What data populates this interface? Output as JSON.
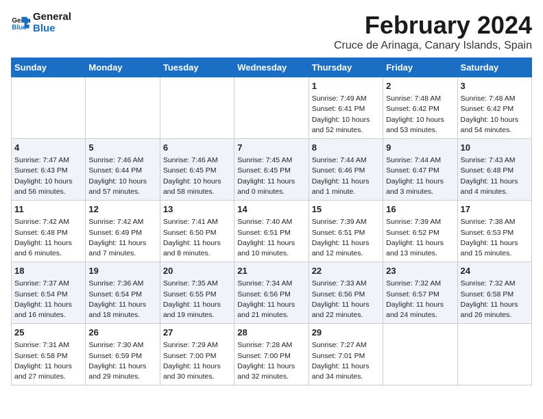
{
  "logo": {
    "text_general": "General",
    "text_blue": "Blue"
  },
  "title": {
    "month": "February 2024",
    "location": "Cruce de Arinaga, Canary Islands, Spain"
  },
  "days_of_week": [
    "Sunday",
    "Monday",
    "Tuesday",
    "Wednesday",
    "Thursday",
    "Friday",
    "Saturday"
  ],
  "weeks": [
    [
      {
        "day": "",
        "info": ""
      },
      {
        "day": "",
        "info": ""
      },
      {
        "day": "",
        "info": ""
      },
      {
        "day": "",
        "info": ""
      },
      {
        "day": "1",
        "info": "Sunrise: 7:49 AM\nSunset: 6:41 PM\nDaylight: 10 hours and 52 minutes."
      },
      {
        "day": "2",
        "info": "Sunrise: 7:48 AM\nSunset: 6:42 PM\nDaylight: 10 hours and 53 minutes."
      },
      {
        "day": "3",
        "info": "Sunrise: 7:48 AM\nSunset: 6:42 PM\nDaylight: 10 hours and 54 minutes."
      }
    ],
    [
      {
        "day": "4",
        "info": "Sunrise: 7:47 AM\nSunset: 6:43 PM\nDaylight: 10 hours and 56 minutes."
      },
      {
        "day": "5",
        "info": "Sunrise: 7:46 AM\nSunset: 6:44 PM\nDaylight: 10 hours and 57 minutes."
      },
      {
        "day": "6",
        "info": "Sunrise: 7:46 AM\nSunset: 6:45 PM\nDaylight: 10 hours and 58 minutes."
      },
      {
        "day": "7",
        "info": "Sunrise: 7:45 AM\nSunset: 6:45 PM\nDaylight: 11 hours and 0 minutes."
      },
      {
        "day": "8",
        "info": "Sunrise: 7:44 AM\nSunset: 6:46 PM\nDaylight: 11 hours and 1 minute."
      },
      {
        "day": "9",
        "info": "Sunrise: 7:44 AM\nSunset: 6:47 PM\nDaylight: 11 hours and 3 minutes."
      },
      {
        "day": "10",
        "info": "Sunrise: 7:43 AM\nSunset: 6:48 PM\nDaylight: 11 hours and 4 minutes."
      }
    ],
    [
      {
        "day": "11",
        "info": "Sunrise: 7:42 AM\nSunset: 6:48 PM\nDaylight: 11 hours and 6 minutes."
      },
      {
        "day": "12",
        "info": "Sunrise: 7:42 AM\nSunset: 6:49 PM\nDaylight: 11 hours and 7 minutes."
      },
      {
        "day": "13",
        "info": "Sunrise: 7:41 AM\nSunset: 6:50 PM\nDaylight: 11 hours and 8 minutes."
      },
      {
        "day": "14",
        "info": "Sunrise: 7:40 AM\nSunset: 6:51 PM\nDaylight: 11 hours and 10 minutes."
      },
      {
        "day": "15",
        "info": "Sunrise: 7:39 AM\nSunset: 6:51 PM\nDaylight: 11 hours and 12 minutes."
      },
      {
        "day": "16",
        "info": "Sunrise: 7:39 AM\nSunset: 6:52 PM\nDaylight: 11 hours and 13 minutes."
      },
      {
        "day": "17",
        "info": "Sunrise: 7:38 AM\nSunset: 6:53 PM\nDaylight: 11 hours and 15 minutes."
      }
    ],
    [
      {
        "day": "18",
        "info": "Sunrise: 7:37 AM\nSunset: 6:54 PM\nDaylight: 11 hours and 16 minutes."
      },
      {
        "day": "19",
        "info": "Sunrise: 7:36 AM\nSunset: 6:54 PM\nDaylight: 11 hours and 18 minutes."
      },
      {
        "day": "20",
        "info": "Sunrise: 7:35 AM\nSunset: 6:55 PM\nDaylight: 11 hours and 19 minutes."
      },
      {
        "day": "21",
        "info": "Sunrise: 7:34 AM\nSunset: 6:56 PM\nDaylight: 11 hours and 21 minutes."
      },
      {
        "day": "22",
        "info": "Sunrise: 7:33 AM\nSunset: 6:56 PM\nDaylight: 11 hours and 22 minutes."
      },
      {
        "day": "23",
        "info": "Sunrise: 7:32 AM\nSunset: 6:57 PM\nDaylight: 11 hours and 24 minutes."
      },
      {
        "day": "24",
        "info": "Sunrise: 7:32 AM\nSunset: 6:58 PM\nDaylight: 11 hours and 26 minutes."
      }
    ],
    [
      {
        "day": "25",
        "info": "Sunrise: 7:31 AM\nSunset: 6:58 PM\nDaylight: 11 hours and 27 minutes."
      },
      {
        "day": "26",
        "info": "Sunrise: 7:30 AM\nSunset: 6:59 PM\nDaylight: 11 hours and 29 minutes."
      },
      {
        "day": "27",
        "info": "Sunrise: 7:29 AM\nSunset: 7:00 PM\nDaylight: 11 hours and 30 minutes."
      },
      {
        "day": "28",
        "info": "Sunrise: 7:28 AM\nSunset: 7:00 PM\nDaylight: 11 hours and 32 minutes."
      },
      {
        "day": "29",
        "info": "Sunrise: 7:27 AM\nSunset: 7:01 PM\nDaylight: 11 hours and 34 minutes."
      },
      {
        "day": "",
        "info": ""
      },
      {
        "day": "",
        "info": ""
      }
    ]
  ]
}
